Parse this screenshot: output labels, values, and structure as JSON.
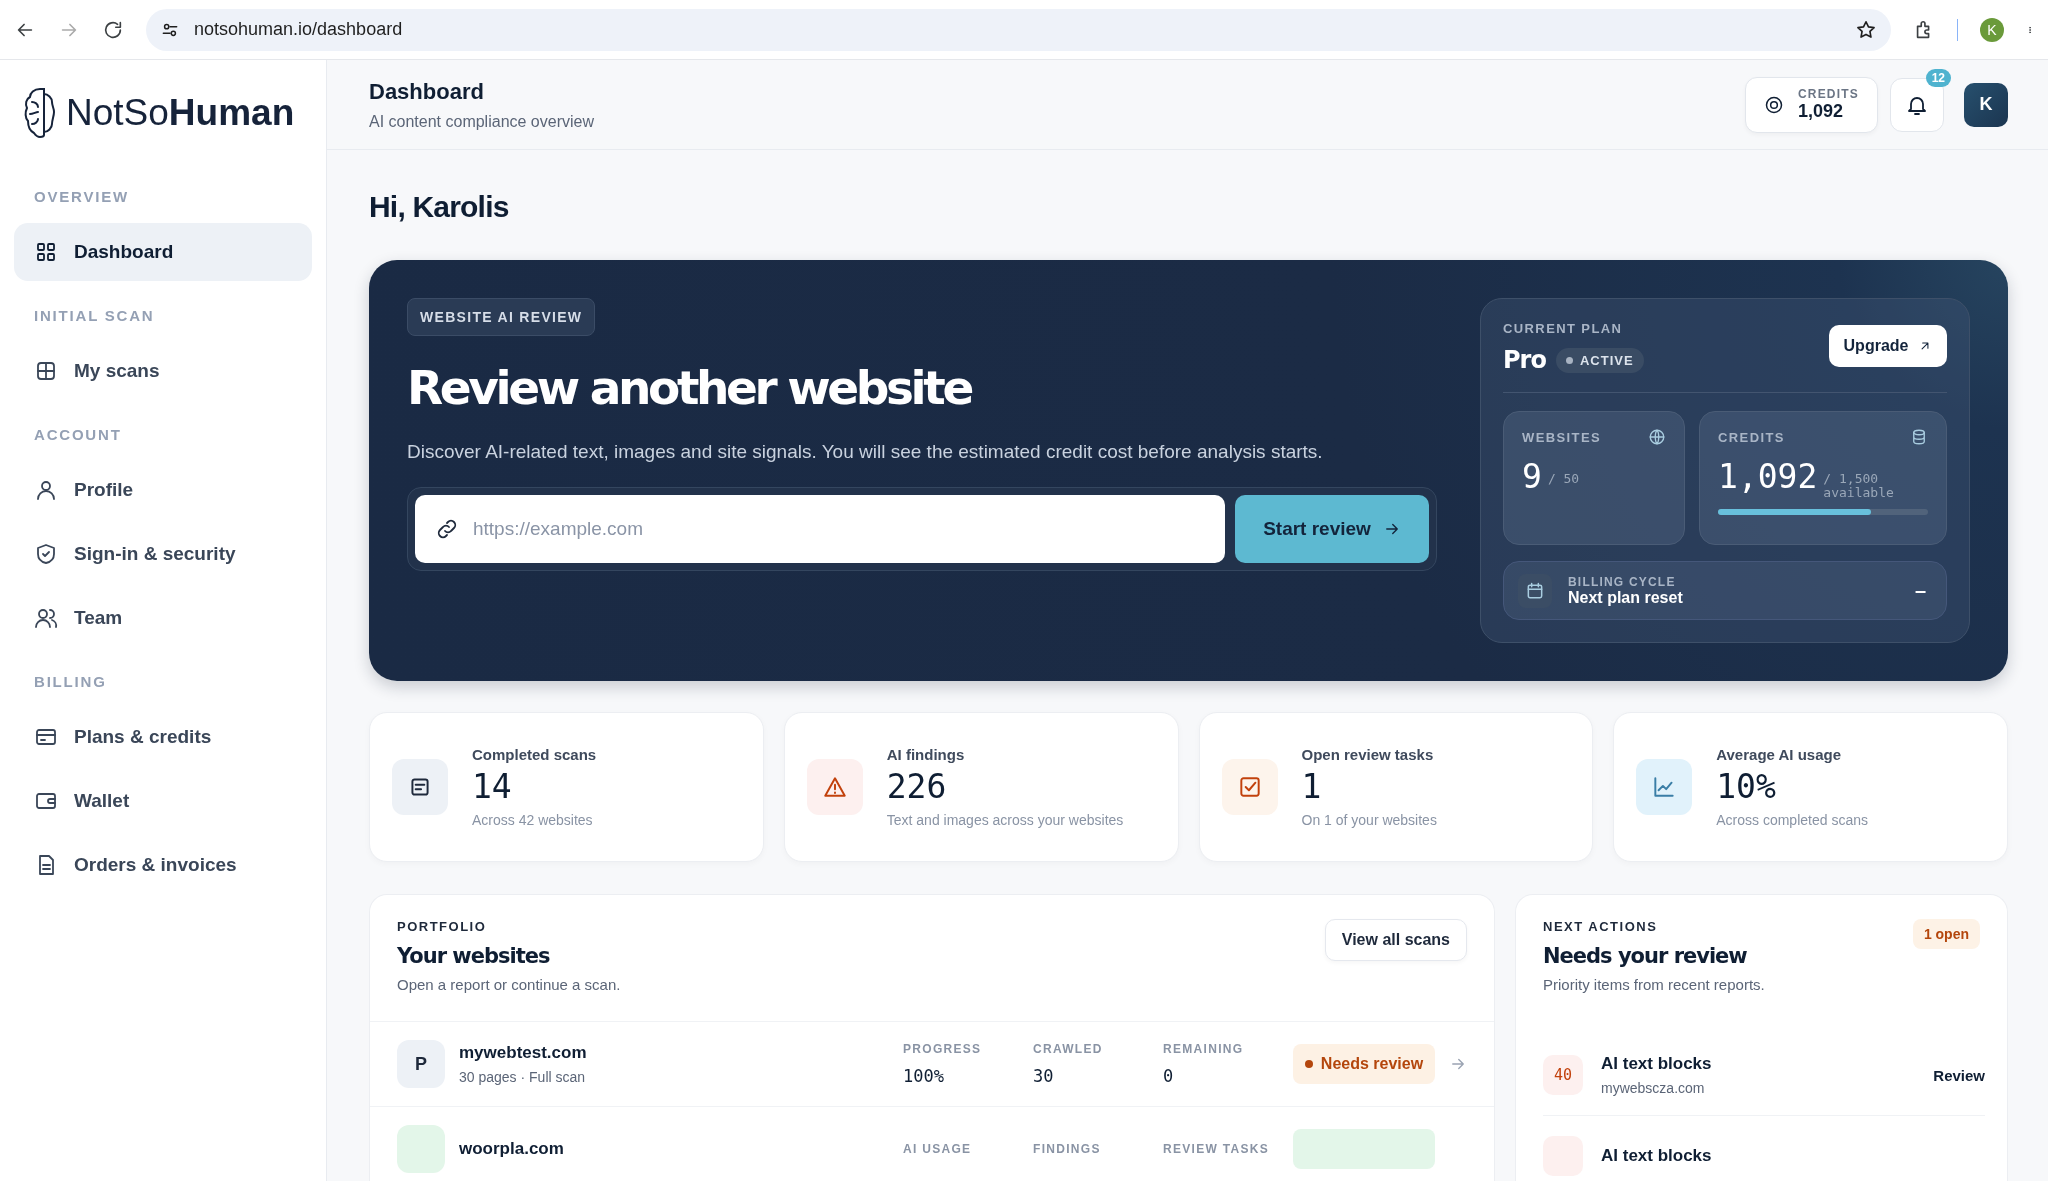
{
  "browser": {
    "url": "notsohuman.io/dashboard",
    "profile": "K"
  },
  "sidebar": {
    "brand": "NotSo**Human**",
    "sections": [
      {
        "title": "OVERVIEW",
        "items": [
          {
            "label": "Dashboard",
            "selected": true
          }
        ]
      },
      {
        "title": "INITIAL SCAN",
        "items": [
          {
            "label": "My scans",
            "selected": false
          }
        ]
      },
      {
        "title": "ACCOUNT",
        "items": [
          {
            "label": "Profile",
            "selected": false
          },
          {
            "label": "Sign-in & security",
            "selected": false
          },
          {
            "label": "Team",
            "selected": false
          }
        ]
      },
      {
        "title": "BILLING",
        "items": [
          {
            "label": "Plans & credits",
            "selected": false
          },
          {
            "label": "Wallet",
            "selected": false
          },
          {
            "label": "Orders & invoices",
            "selected": false
          }
        ]
      }
    ]
  },
  "header": {
    "title": "Dashboard",
    "subtitle": "AI content compliance overview",
    "credits_label": "CREDITS",
    "credits_value": "1,092",
    "notifications": "12",
    "avatar": "K"
  },
  "greeting": "Hi, Karolis",
  "hero": {
    "badge": "WEBSITE AI REVIEW",
    "title": "Review another website",
    "description": "Discover AI-related text, images and site signals. You will see the estimated credit cost before analysis starts.",
    "url_field": {
      "placeholder": "https://example.com"
    },
    "button": "Start review",
    "plan": {
      "label": "CURRENT PLAN",
      "name": "Pro",
      "status": "ACTIVE",
      "upgrade": "Upgrade",
      "websites": {
        "label": "WEBSITES",
        "value": "9",
        "total": "/ 50"
      },
      "credits": {
        "label": "CREDITS",
        "value": "1,092",
        "total": "/ 1,500",
        "note": "available",
        "level": 0.73
      },
      "billing": {
        "label": "BILLING CYCLE",
        "value": "Next plan reset",
        "reading": "–"
      }
    }
  },
  "stats": [
    {
      "kind": "scans",
      "label": "Completed scans",
      "value": "14",
      "note": "Across 42 websites"
    },
    {
      "kind": "findings",
      "label": "AI findings",
      "value": "226",
      "note": "Text and images across your websites"
    },
    {
      "kind": "tasks",
      "label": "Open review tasks",
      "value": "1",
      "note": "On 1 of your websites"
    },
    {
      "kind": "usage",
      "label": "Average AI usage",
      "value": "10%",
      "note": "Across completed scans"
    }
  ],
  "portfolio": {
    "label": "PORTFOLIO",
    "title": "Your websites",
    "subtitle": "Open a report or continue a scan.",
    "button": "View all scans",
    "rows": [
      {
        "avatar": "P",
        "color": "#edf1f6",
        "name": "mywebtest.com",
        "meta": "30 pages · Full scan",
        "metrics": [
          {
            "label": "PROGRESS",
            "value": "100%"
          },
          {
            "label": "CRAWLED",
            "value": "30"
          },
          {
            "label": "REMAINING",
            "value": "0"
          }
        ],
        "status": {
          "color": "#fdf1e4",
          "label": "Needs review"
        }
      },
      {
        "color": "#e3f6e9",
        "name": "woorpla.com",
        "metrics": [
          {
            "label": "AI USAGE"
          },
          {
            "label": "FINDINGS"
          },
          {
            "label": "REVIEW TASKS"
          }
        ],
        "status": {
          "color": "#e3f6e9"
        }
      }
    ]
  },
  "next_actions": {
    "label": "NEXT ACTIONS",
    "title": "Needs your review",
    "subtitle": "Priority items from recent reports.",
    "badge": "1 open",
    "items": [
      {
        "count": "40",
        "title": "AI text blocks",
        "site": "mywebscza.com",
        "action": "Review"
      },
      {
        "title": "AI text blocks"
      }
    ]
  }
}
